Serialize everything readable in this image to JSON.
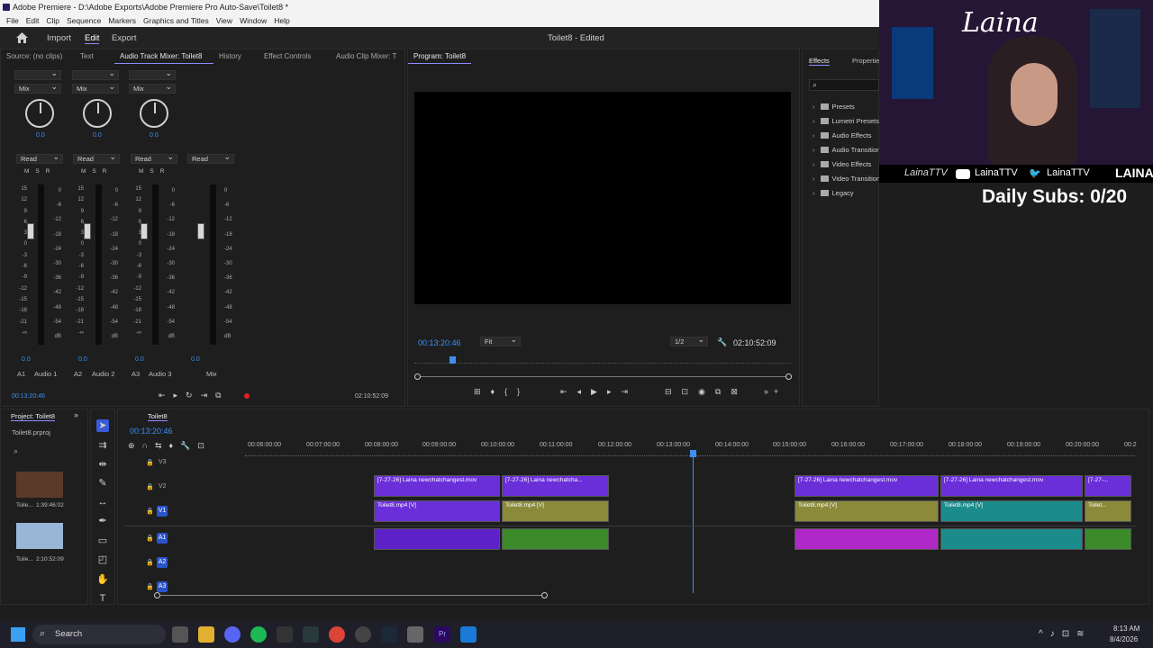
{
  "window": {
    "title": "Adobe Premiere - D:\\Adobe Exports\\Adobe Premiere Pro Auto-Save\\Toilet8 *"
  },
  "menu": [
    "File",
    "Edit",
    "Clip",
    "Sequence",
    "Markers",
    "Graphics and Titles",
    "View",
    "Window",
    "Help"
  ],
  "workspace": {
    "import": "Import",
    "edit": "Edit",
    "export": "Export",
    "doc": "Toilet8 - Edited"
  },
  "left_tabs": [
    "Source: (no clips)",
    "Text",
    "Audio Track Mixer: Toilet8",
    "History",
    "Effect Controls",
    "Audio Clip Mixer: T"
  ],
  "mixer": {
    "pan_value": "0.0",
    "mix_label": "Mix",
    "read_label": "Read",
    "msr": [
      "M",
      "S",
      "R"
    ],
    "scale": [
      "dB",
      "0",
      "-6",
      "-12",
      "-18",
      "-24",
      "-30",
      "-36",
      "-42",
      "-48",
      "-54",
      "dB"
    ],
    "scale_left": [
      "dB",
      "15",
      "12",
      "9",
      "6",
      "3",
      "0",
      "-3",
      "-6",
      "-9",
      "-12",
      "-15",
      "-18",
      "-21",
      "-∞"
    ],
    "values": [
      "0.0",
      "0.0",
      "0.0",
      "0.0"
    ],
    "channels": [
      {
        "id": "A1",
        "name": "Audio 1"
      },
      {
        "id": "A2",
        "name": "Audio 2"
      },
      {
        "id": "A3",
        "name": "Audio 3"
      },
      {
        "id": "",
        "name": "Mix"
      }
    ],
    "timecode_in": "00:13:20:46",
    "timecode_out": "02:10:52:09"
  },
  "program": {
    "tab": "Program: Toilet8",
    "timecode": "00:13:20:46",
    "fit": "Fit",
    "quality": "1/2",
    "duration": "02:10:52:09"
  },
  "effects": {
    "tabs": [
      "Effects",
      "Properties"
    ],
    "items": [
      "Presets",
      "Lumetri Presets",
      "Audio Effects",
      "Audio Transitions",
      "Video Effects",
      "Video Transitions",
      "Legacy"
    ]
  },
  "overlay": {
    "name": "Laina",
    "handles": [
      "LainaTTV",
      "LainaTTV",
      "LainaTTV",
      "LAINA"
    ],
    "subs": "Daily Subs: 0/20"
  },
  "project": {
    "tab": "Project: Toilet8",
    "file": "Toilet8.prproj",
    "items": [
      {
        "name": "Toile...",
        "duration": "1:39:46:02"
      },
      {
        "name": "Toile...",
        "duration": "2:10:52:09"
      }
    ]
  },
  "timeline": {
    "tab": "Toilet8",
    "timecode": "00:13:20:46",
    "ruler": [
      "00:06:00:00",
      "00:07:00:00",
      "00:08:00:00",
      "00:09:00:00",
      "00:10:00:00",
      "00:11:00:00",
      "00:12:00:00",
      "00:13:00:00",
      "00:14:00:00",
      "00:15:00:00",
      "00:16:00:00",
      "00:17:00:00",
      "00:18:00:00",
      "00:19:00:00",
      "00:20:00:00",
      "00:2"
    ],
    "tracks": [
      "V3",
      "V2",
      "V1",
      "A1",
      "A2",
      "A3"
    ],
    "clip_v2": "[7-27-26] Laina newchatchangest.mov",
    "clip_v2_short": "[7-27-26] Laina newchatcha...",
    "clip_v2_tiny": "[7-27-...",
    "clip_v1": "Toilet8.mp4 [V]",
    "clip_v1_tiny": "Toilet..."
  },
  "taskbar": {
    "search": "Search",
    "time": "8:13 AM",
    "date": "8/4/2026"
  }
}
